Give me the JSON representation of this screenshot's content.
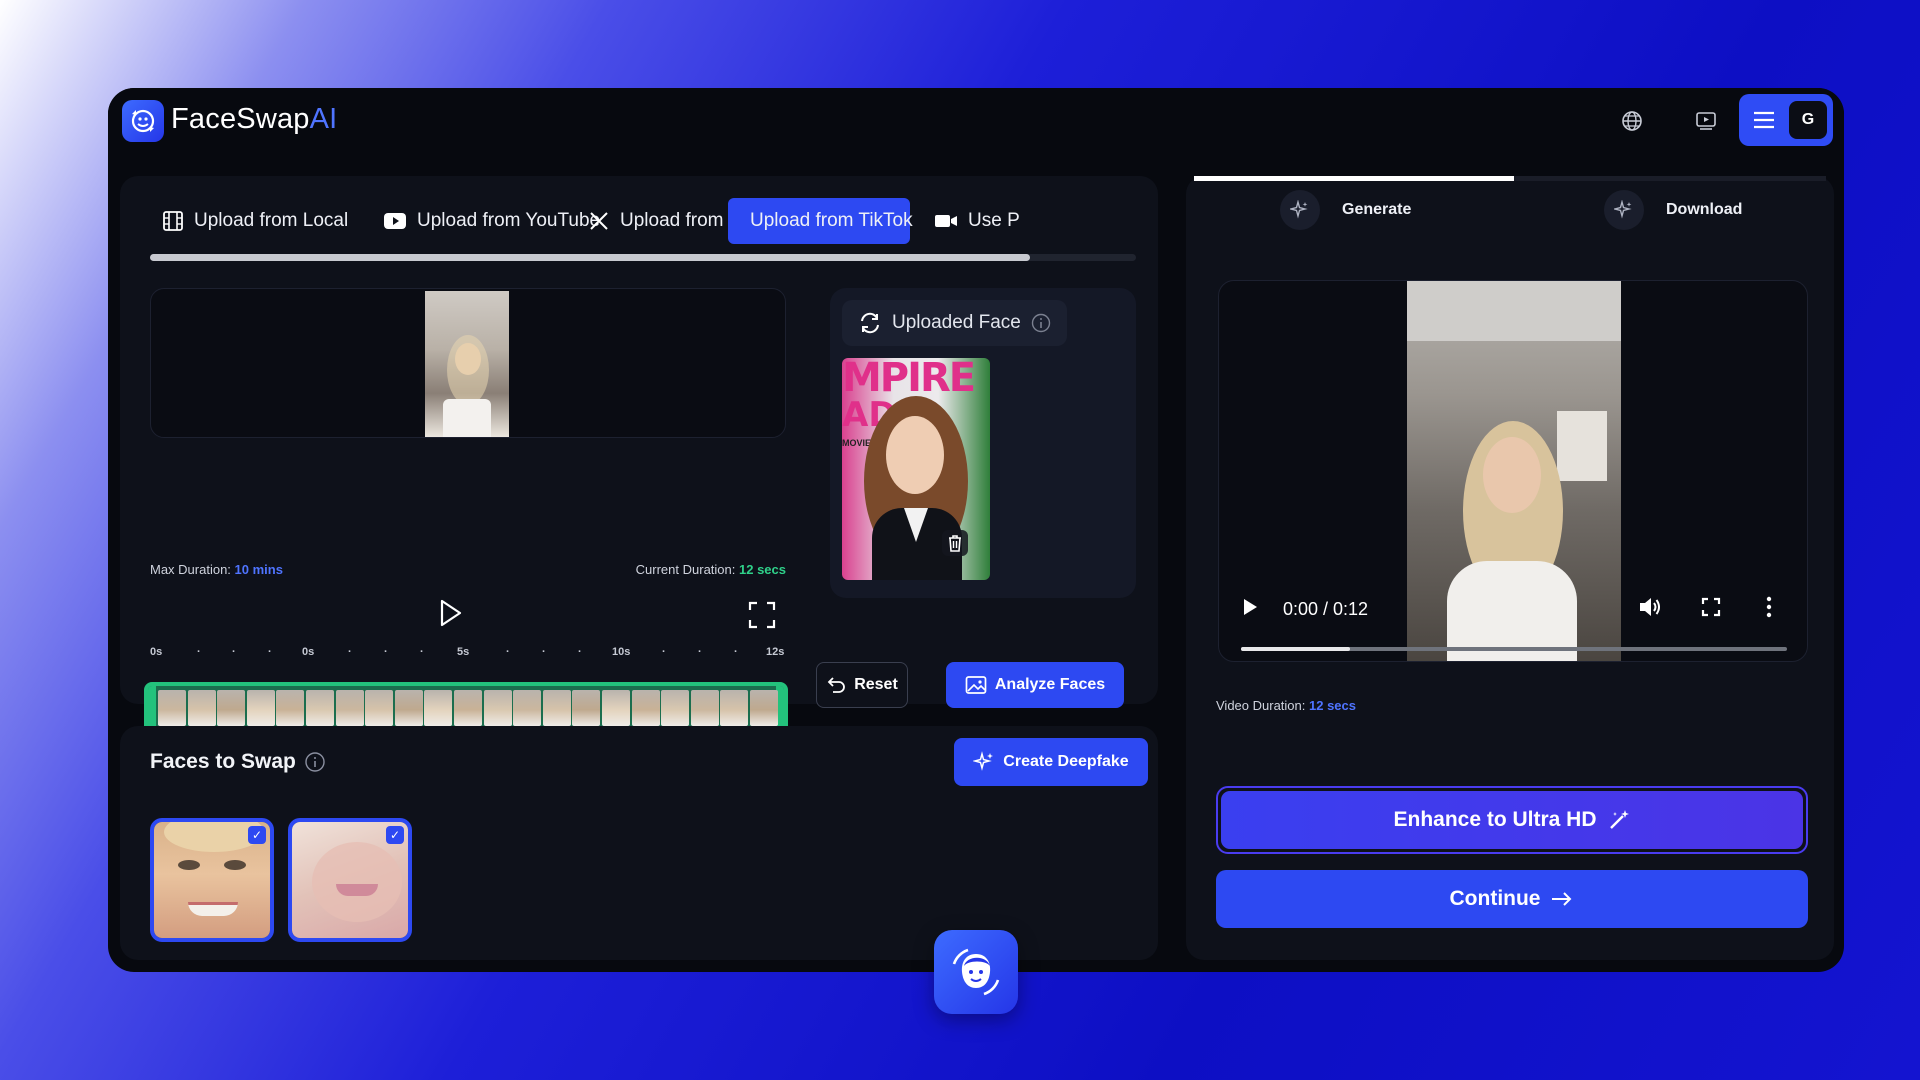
{
  "header": {
    "brand_part1": "FaceSwap",
    "brand_part2": "AI",
    "avatar_initial": "G",
    "icons": [
      "logo-icon",
      "globe-icon",
      "tutorial-video-icon",
      "hamburger-menu-icon"
    ]
  },
  "upload_tabs": [
    {
      "label": "Upload from Local",
      "icon": "film-icon",
      "active": false
    },
    {
      "label": "Upload from YouTube",
      "icon": "youtube-icon",
      "active": false
    },
    {
      "label": "Upload from X",
      "icon": "x-icon",
      "active": false
    },
    {
      "label": "Upload from TikTok",
      "icon": "tiktok-icon",
      "active": true
    },
    {
      "label": "Use P",
      "icon": "camera-icon",
      "active": false
    }
  ],
  "editor": {
    "max_duration_label": "Max Duration:",
    "max_duration_value": "10 mins",
    "current_duration_label": "Current Duration:",
    "current_duration_value": "12 secs",
    "ruler_ticks": [
      "0s",
      "0s",
      "5s",
      "10s",
      "12s"
    ]
  },
  "uploaded_face": {
    "label": "Uploaded Face",
    "magazine_text": "MPIRE",
    "magazine_text2": "AD",
    "magazine_text3": "MOVIE"
  },
  "actions": {
    "reset_label": "Reset",
    "analyze_label": "Analyze Faces"
  },
  "faces_to_swap": {
    "title": "Faces to Swap",
    "create_label": "Create Deepfake",
    "count": 2
  },
  "steps": [
    {
      "label": "Generate",
      "icon": "sparkle-icon"
    },
    {
      "label": "Download",
      "icon": "sparkle-icon"
    }
  ],
  "player": {
    "time": "0:00 / 0:12",
    "progress": 0.2
  },
  "result": {
    "video_duration_label": "Video Duration:",
    "video_duration_value": "12 secs",
    "enhance_label": "Enhance to Ultra HD",
    "continue_label": "Continue"
  },
  "colors": {
    "accent": "#2d49f2",
    "brand_ai": "#4f74ff",
    "success": "#23c27c",
    "panel": "#0e111a"
  }
}
